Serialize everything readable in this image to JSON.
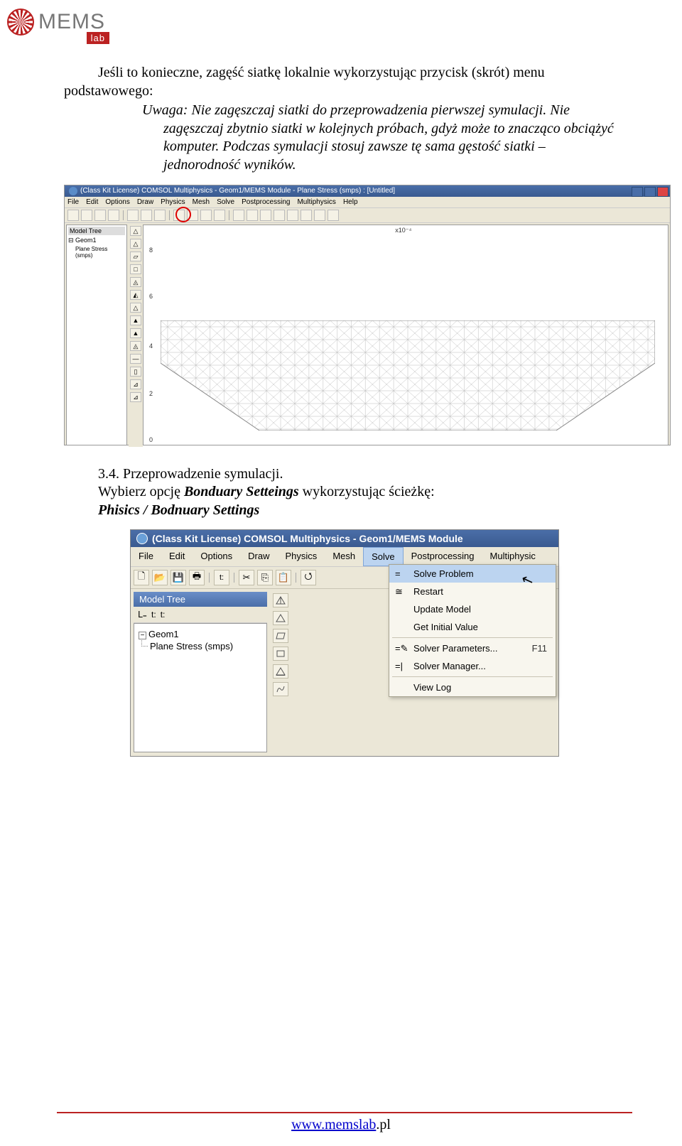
{
  "logo": {
    "brand": "MEMS",
    "sub": "lab"
  },
  "para1_lead": "Jeśli to konieczne, zagęść siatkę lokalnie wykorzystując przycisk (skrót) menu podstawowego:",
  "para1_note": "Uwaga: Nie zagęszczaj siatki do przeprowadzenia pierwszej symulacji. Nie zagęszczaj zbytnio siatki w kolejnych próbach, gdyż może to znacząco obciążyć komputer. Podczas symulacji stosuj zawsze tę sama gęstość siatki – jednorodność wyników.",
  "comsol1": {
    "title": "(Class Kit License) COMSOL Multiphysics - Geom1/MEMS Module - Plane Stress (smps) : [Untitled]",
    "menus": [
      "File",
      "Edit",
      "Options",
      "Draw",
      "Physics",
      "Mesh",
      "Solve",
      "Postprocessing",
      "Multiphysics",
      "Help"
    ],
    "tree_title": "Model Tree",
    "tree_root": "Geom1",
    "tree_child": "Plane Stress (smps)",
    "axis_exp": "x10⁻⁴",
    "yticks": [
      "8",
      "6",
      "4",
      "2",
      "0"
    ]
  },
  "section34": "3.4. Przeprowadzenie symulacji.",
  "section34_body_pre": "Wybierz opcję ",
  "section34_body_bold": "Bonduary Setteings",
  "section34_body_mid": " wykorzystując ścieżkę:",
  "section34_path": "Phisics / Bodnuary Settings",
  "comsol2": {
    "title": "(Class Kit License) COMSOL Multiphysics - Geom1/MEMS Module",
    "menus": [
      "File",
      "Edit",
      "Options",
      "Draw",
      "Physics",
      "Mesh",
      "Solve",
      "Postprocessing",
      "Multiphysic"
    ],
    "tree_title": "Model Tree",
    "tree_root": "Geom1",
    "tree_child": "Plane Stress (smps)",
    "dropdown": {
      "solve_problem": "Solve Problem",
      "restart": "Restart",
      "update_model": "Update Model",
      "get_initial": "Get Initial Value",
      "solver_params": "Solver Parameters...",
      "solver_params_kb": "F11",
      "solver_manager": "Solver Manager...",
      "view_log": "View Log"
    }
  },
  "footer": {
    "link": "www.memslab",
    "tld": ".pl"
  }
}
